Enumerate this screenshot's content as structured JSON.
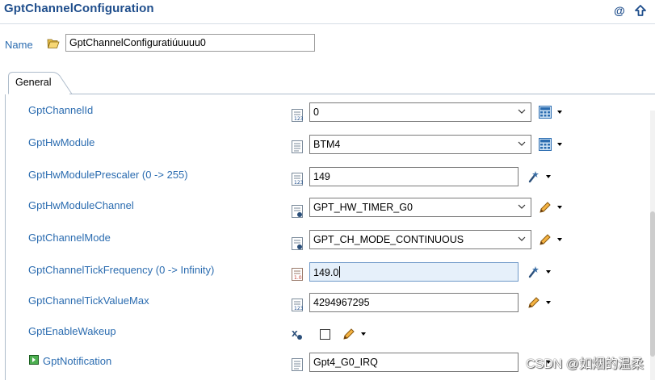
{
  "header": {
    "title": "GptChannelConfiguration"
  },
  "name_field": {
    "label": "Name",
    "value": "GptChannelConfiguratiúuuuu0"
  },
  "tabs": [
    {
      "label": "General"
    }
  ],
  "params": [
    {
      "label": "GptChannelId",
      "value": "0"
    },
    {
      "label": "GptHwModule",
      "value": "BTM4"
    },
    {
      "label": "GptHwModulePrescaler (0 -> 255)",
      "value": "149"
    },
    {
      "label": "GptHwModuleChannel",
      "value": "GPT_HW_TIMER_G0"
    },
    {
      "label": "GptChannelMode",
      "value": "GPT_CH_MODE_CONTINUOUS"
    },
    {
      "label": "GptChannelTickFrequency (0 -> Infinity)",
      "value": "149.0"
    },
    {
      "label": "GptChannelTickValueMax",
      "value": "4294967295"
    },
    {
      "label": "GptEnableWakeup",
      "checked": false
    },
    {
      "label": "GptNotification",
      "value": "Gpt4_G0_IRQ"
    }
  ],
  "watermark": "CSDN @如烟的温柔",
  "colors": {
    "title": "#1f4e8c",
    "label": "#2b6cb0",
    "highlight": "#e6f0fa"
  }
}
